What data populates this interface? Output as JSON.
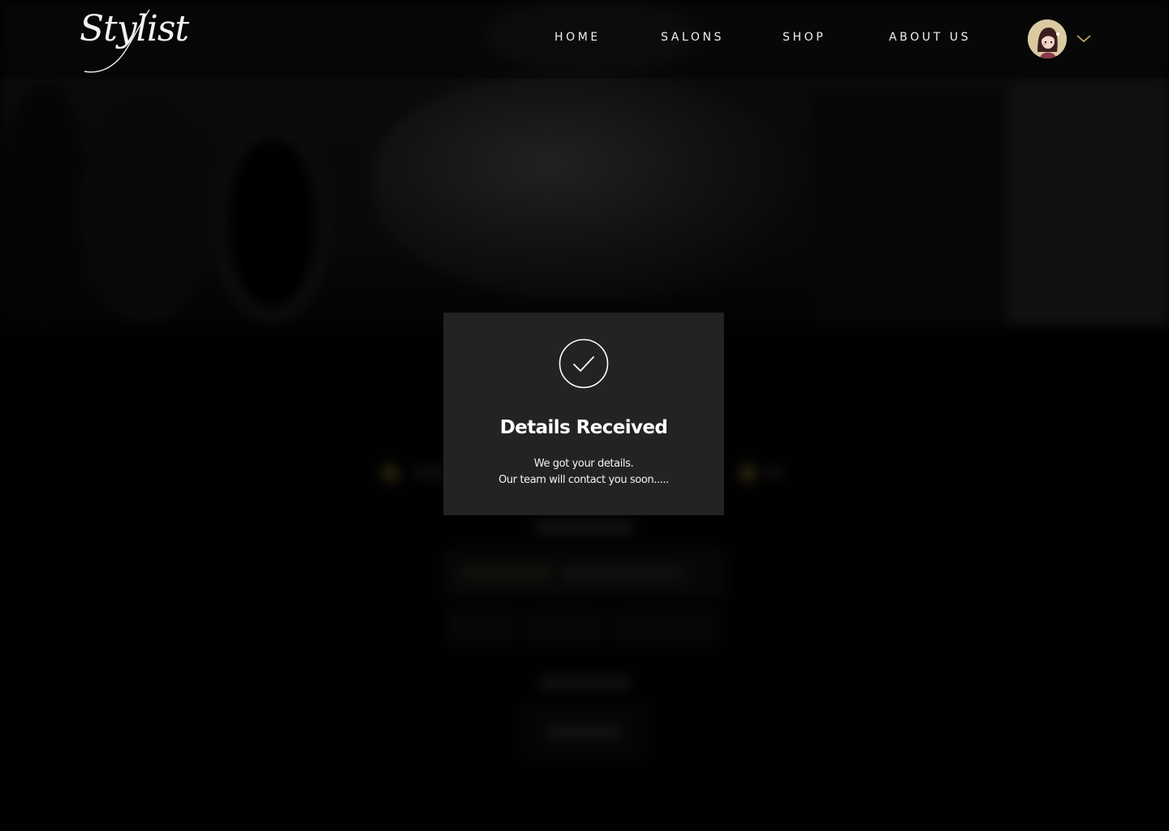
{
  "brand": {
    "logo_text": "Stylist"
  },
  "nav": {
    "items": [
      {
        "label": "HOME"
      },
      {
        "label": "SALONS"
      },
      {
        "label": "SHOP"
      },
      {
        "label": "ABOUT US"
      }
    ]
  },
  "account": {
    "avatar_icon": "user-avatar-icon",
    "menu_icon": "chevron-down-icon"
  },
  "modal": {
    "icon": "check-circle-icon",
    "title": "Details Received",
    "message_line_1": "We got your details.",
    "message_line_2": "Our team will contact you soon....."
  },
  "colors": {
    "background": "#040404",
    "modal_background": "#232323",
    "accent_gold": "#c9a96a",
    "text": "#ffffff"
  }
}
